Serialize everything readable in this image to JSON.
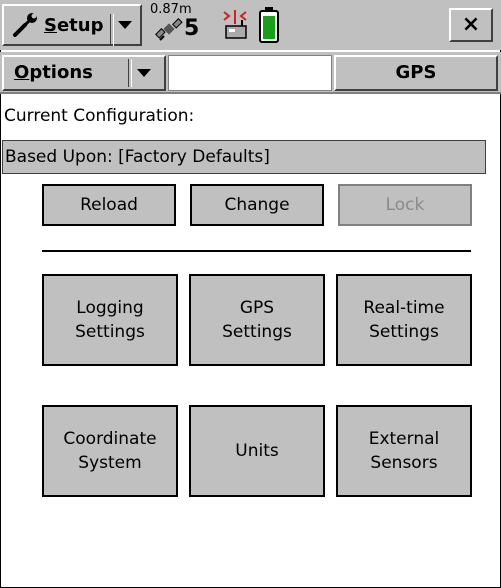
{
  "toolbar": {
    "setup_label_u": "S",
    "setup_label_rest": "etup",
    "accuracy": "0.87m",
    "satellite_count": "5",
    "close_label": "×",
    "icons": {
      "setup": "wrench-icon",
      "satellite": "satellite-icon",
      "realtime": "realtime-receiver-icon",
      "battery": "battery-icon"
    },
    "battery_level": 0.85,
    "battery_color": "#1a9f1a",
    "signal_color": "#cc2222"
  },
  "tabs": {
    "options_u": "O",
    "options_rest": "ptions",
    "gps_label": "GPS"
  },
  "config": {
    "title": "Current Configuration:",
    "based_upon": "Based Upon: [Factory Defaults]"
  },
  "actions": {
    "reload": "Reload",
    "change": "Change",
    "lock": "Lock"
  },
  "settings": {
    "logging": "Logging\nSettings",
    "gps": "GPS\nSettings",
    "realtime": "Real-time\nSettings",
    "coordinate": "Coordinate\nSystem",
    "units": "Units",
    "external": "External\nSensors"
  }
}
